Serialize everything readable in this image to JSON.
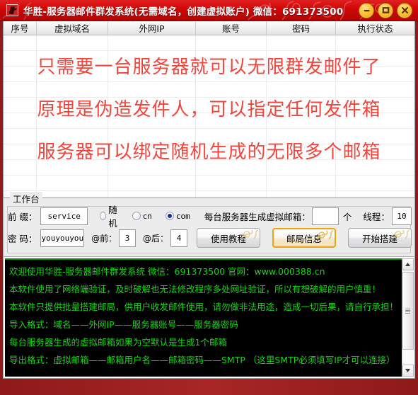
{
  "window": {
    "title": "华胜-服务器邮件群发系统(无需域名，创建虚拟账户) 微信：691373500",
    "icon": "app-logo-icon",
    "controls": {
      "minimize": "－",
      "maximize": "□",
      "close": "✕"
    },
    "accent_red": "#d20808",
    "border_red": "#8e1a1a"
  },
  "table": {
    "columns": [
      "序号",
      "虚拟域名",
      "外网IP",
      "账号",
      "密码",
      "执行状态"
    ],
    "rows": []
  },
  "promo": {
    "lines": [
      "只需要一台服务器就可以无限群发邮件了",
      "原理是伪造发件人，可以指定任何发件箱",
      "服务器可以绑定随机生成的无限多个邮箱"
    ],
    "color": "#f4453c"
  },
  "workbench": {
    "group_label": "工作台",
    "prefix_label": "前 缀：",
    "prefix_value": "service",
    "prefix_placeholder": "",
    "domain_options": [
      {
        "label": "随机",
        "selected": false
      },
      {
        "label": "cn",
        "selected": false
      },
      {
        "label": "com",
        "selected": true
      }
    ],
    "mailbox_label": "每台服务器生成虚拟邮箱：",
    "mailbox_value": "",
    "mailbox_placeholder": "",
    "mailbox_unit": "个",
    "thread_label": "线程：",
    "thread_value": "10",
    "password_label": "密 码：",
    "password_value": "youyouyou",
    "at_before_label": "@前：",
    "at_before_value": "3",
    "at_after_label": "@后：",
    "at_after_value": "4",
    "buttons": [
      {
        "label": "使用教程",
        "highlighted": false
      },
      {
        "label": "邮局信息",
        "highlighted": true
      },
      {
        "label": "开始搭建",
        "highlighted": false
      }
    ],
    "highlight_color": "#f0a30a"
  },
  "console": {
    "text_color": "#15d615",
    "background": "#000000",
    "lines": [
      "欢迎使用华胜-服务器邮件群发系统 微信：691373500 官网：www.000388.cn",
      "本软件使用了网络端验证，及时破解也无法修改程序多处网址验证，所以有想破解的用户慎重！",
      "本软件只提供批量搭建邮局，供用户收发邮件使用，请勿做非法用途，造成一切后果，请自行承担！",
      "导入格式：域名——外网IP——服务器账号——服务器密码",
      "每台服务器生成的虚拟邮箱如果为空默认是生成1个邮箱",
      "导出格式：虚拟邮箱——邮箱用户名——邮箱密码——SMTP （这里SMTP必须填写IP才可以连接）"
    ],
    "scrollbar": {
      "up": "▲",
      "down": "▼"
    }
  }
}
